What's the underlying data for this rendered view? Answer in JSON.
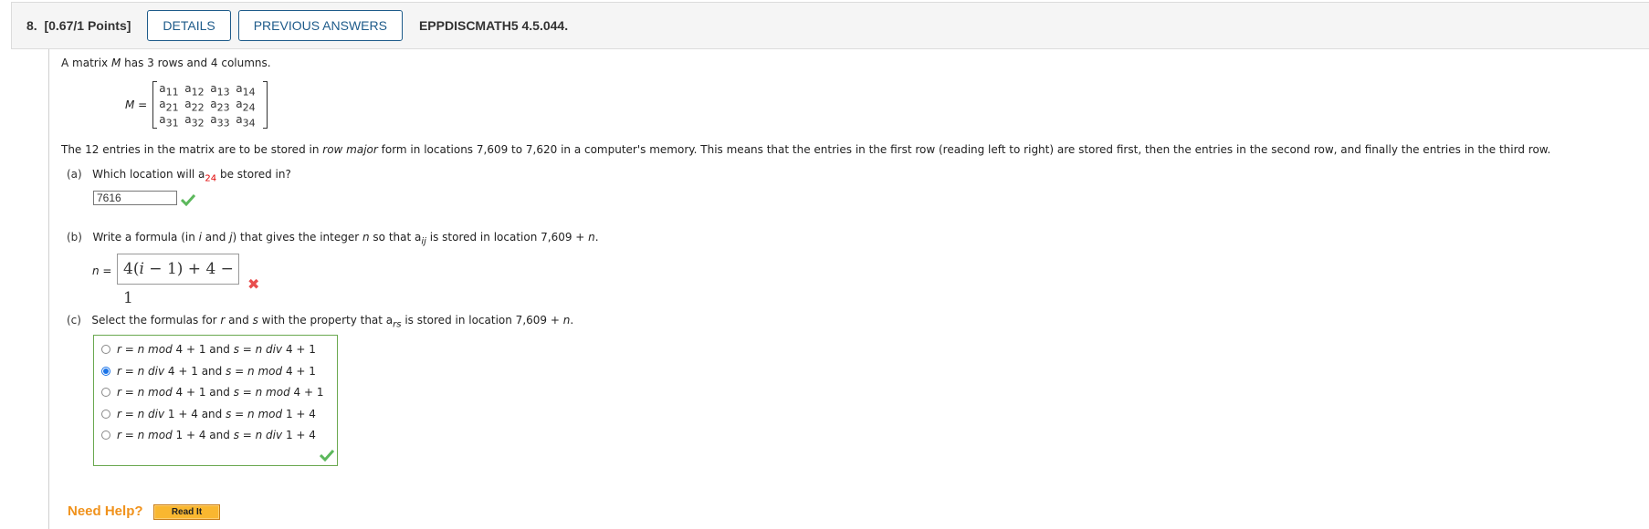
{
  "header": {
    "question_number": "8.",
    "points": "[0.67/1 Points]",
    "details_button": "DETAILS",
    "previous_answers_button": "PREVIOUS ANSWERS",
    "problem_code": "EPPDISCMATH5 4.5.044."
  },
  "intro": {
    "before_M": "A matrix ",
    "M": "M",
    "after_M": " has 3 rows and 4 columns."
  },
  "matrix": {
    "label": "M =",
    "rows": [
      [
        "11",
        "12",
        "13",
        "14"
      ],
      [
        "21",
        "22",
        "23",
        "24"
      ],
      [
        "31",
        "32",
        "33",
        "34"
      ]
    ],
    "entry_letter": "a"
  },
  "description": {
    "part1": "The 12 entries in the matrix are to be stored in ",
    "italic": "row major",
    "part2": " form in locations 7,609 to 7,620 in a computer's memory. This means that the entries in the first row (reading left to right) are stored first, then the entries in the second row, and finally the entries in the third row."
  },
  "part_a": {
    "label": "(a)",
    "q_before": "Which location will a",
    "q_sub": "24",
    "q_after": " be stored in?",
    "answer": "7616",
    "status": "correct"
  },
  "part_b": {
    "label": "(b)",
    "q1": "Write a formula (in ",
    "i": "i",
    "q2": " and ",
    "j": "j",
    "q3": ") that gives the integer ",
    "n": "n",
    "q4": " so that a",
    "q_sub": "ij",
    "q5": " is stored in location 7,609 + ",
    "q6": ".",
    "n_label": "n =",
    "answer_parts": [
      "4(",
      "i",
      " − 1) + 4 − 1"
    ],
    "status": "incorrect"
  },
  "part_c": {
    "label": "(c)",
    "q1": "Select the formulas for ",
    "r": "r",
    "q2": " and ",
    "s": "s",
    "q3": " with the property that a",
    "q_sub": "rs",
    "q4": " is stored in location 7,609 + ",
    "q5": ".",
    "options": [
      {
        "r_expr": "n mod",
        "r_rest": " 4 + 1",
        "s_expr": "n div",
        "s_rest": " 4 + 1",
        "selected": false
      },
      {
        "r_expr": "n div",
        "r_rest": " 4 + 1",
        "s_expr": "n mod",
        "s_rest": " 4 + 1",
        "selected": true
      },
      {
        "r_expr": "n mod",
        "r_rest": " 4 + 1",
        "s_expr": "n mod",
        "s_rest": " 4 + 1",
        "selected": false
      },
      {
        "r_expr": "n div",
        "r_rest": " 1 + 4",
        "s_expr": "n mod",
        "s_rest": " 1 + 4",
        "selected": false
      },
      {
        "r_expr": "n mod",
        "r_rest": " 1 + 4",
        "s_expr": "n div",
        "s_rest": " 1 + 4",
        "selected": false
      }
    ],
    "and_word": " and ",
    "r_eq": "r = ",
    "s_eq": "s = ",
    "status": "correct"
  },
  "help": {
    "label": "Need Help?",
    "read_it_button": "Read It"
  },
  "colors": {
    "accent": "#1e5b8a",
    "correct": "#5cb85c",
    "incorrect": "#e84d4d",
    "help": "#f0921c"
  }
}
